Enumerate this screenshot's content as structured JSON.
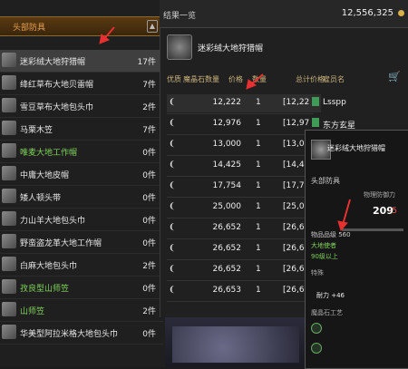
{
  "left_panel": {
    "header": "头部防具",
    "items": [
      {
        "name": "迷彩绒大地狩猎帽",
        "count": "17件",
        "green": false
      },
      {
        "name": "绛红草布大地贝雷帽",
        "count": "7件",
        "green": false
      },
      {
        "name": "雪豆草布大地包头巾",
        "count": "2件",
        "green": false
      },
      {
        "name": "马栗木笠",
        "count": "7件",
        "green": false
      },
      {
        "name": "唯麦大地工作帽",
        "count": "0件",
        "green": true
      },
      {
        "name": "中庸大地皮帽",
        "count": "0件",
        "green": false
      },
      {
        "name": "矮人顿头带",
        "count": "0件",
        "green": false
      },
      {
        "name": "力山羊大地包头巾",
        "count": "0件",
        "green": false
      },
      {
        "name": "野蛮盗龙革大地工作帽",
        "count": "0件",
        "green": false
      },
      {
        "name": "白麻大地包头巾",
        "count": "2件",
        "green": false
      },
      {
        "name": "孜良型山师笠",
        "count": "0件",
        "green": true
      },
      {
        "name": "山师笠",
        "count": "2件",
        "green": true
      },
      {
        "name": "华美型阿拉米格大地包头巾",
        "count": "0件",
        "green": false
      }
    ]
  },
  "results": {
    "title": "结果一览",
    "gil": "12,556,325",
    "item_name": "迷彩绒大地狩猎帽",
    "columns": {
      "hq": "优质",
      "materia": "魔晶石数量",
      "price": "价格",
      "qty": "数量",
      "total": "总计价格",
      "retainer": "雇员名"
    },
    "rows": [
      {
        "price": "12,222",
        "qty": "1",
        "total": "[12,22",
        "retainer": "Lsspp"
      },
      {
        "price": "12,976",
        "qty": "1",
        "total": "[12,97",
        "retainer": "东方玄星"
      },
      {
        "price": "13,000",
        "qty": "1",
        "total": "[13,00",
        "retainer": ""
      },
      {
        "price": "14,425",
        "qty": "1",
        "total": "[14,42",
        "retainer": ""
      },
      {
        "price": "17,754",
        "qty": "1",
        "total": "[17,75",
        "retainer": ""
      },
      {
        "price": "25,000",
        "qty": "1",
        "total": "[25,00",
        "retainer": ""
      },
      {
        "price": "26,652",
        "qty": "1",
        "total": "[26,65",
        "retainer": ""
      },
      {
        "price": "26,652",
        "qty": "1",
        "total": "[26,65",
        "retainer": ""
      },
      {
        "price": "26,652",
        "qty": "1",
        "total": "[26,65",
        "retainer": ""
      },
      {
        "price": "26,653",
        "qty": "1",
        "total": "[26,65",
        "retainer": ""
      }
    ]
  },
  "tooltip": {
    "name": "迷彩绒大地狩猎帽",
    "category": "头部防具",
    "defense_label": "物理防御力",
    "defense": "209",
    "defense_diff": "-5",
    "ilvl": "物品品级 560",
    "job": "大地使者",
    "level": "90级以上",
    "section": "特殊",
    "durability": "耐力 +46",
    "materia": "魔晶石工艺"
  }
}
